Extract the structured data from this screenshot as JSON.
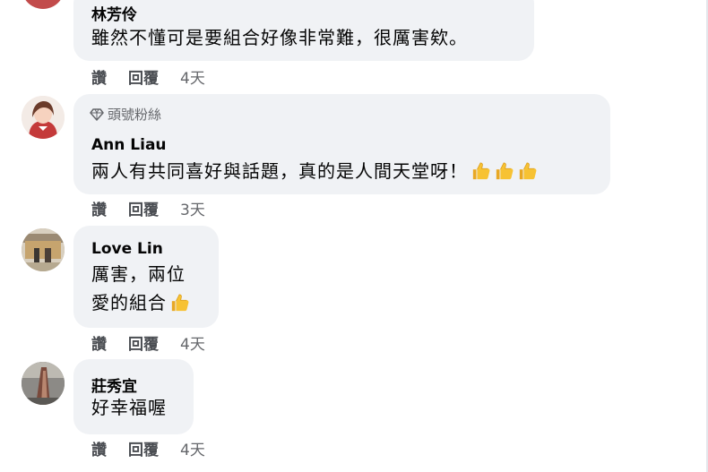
{
  "comments": [
    {
      "author": "林芳伶",
      "text": "雖然不懂可是要組合好像非常難，很厲害欸。",
      "like": "讚",
      "reply": "回覆",
      "time": "4天"
    },
    {
      "badge": "頭號粉絲",
      "badge_icon": "diamond-icon",
      "author": "Ann Liau",
      "text": "兩人有共同喜好與話題，真的是人間天堂呀！",
      "emoji": [
        "thumbs-up-icon",
        "thumbs-up-icon",
        "thumbs-up-icon"
      ],
      "like": "讚",
      "reply": "回覆",
      "time": "3天"
    },
    {
      "author": "Love Lin",
      "text_line1": "厲害，兩位",
      "text_line2": "愛的組合",
      "emoji": [
        "thumbs-up-icon"
      ],
      "like": "讚",
      "reply": "回覆",
      "time": "4天"
    },
    {
      "author": "莊秀宜",
      "text": "好幸福喔",
      "like": "讚",
      "reply": "回覆",
      "time": "4天"
    }
  ],
  "colors": {
    "bubble": "#f0f2f5",
    "action_text": "#4a4d52",
    "meta_text": "#65676b"
  }
}
